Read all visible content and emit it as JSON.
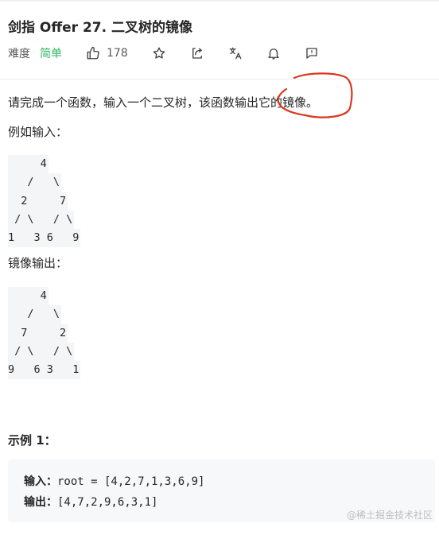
{
  "problem": {
    "title": "剑指 Offer 27. 二叉树的镜像",
    "difficulty_label": "难度",
    "difficulty_value": "简单",
    "likes": "178"
  },
  "toolbar_icons": [
    "thumbs-up-icon",
    "star-icon",
    "share-icon",
    "translate-icon",
    "bell-icon",
    "feedback-icon"
  ],
  "description": {
    "intro": "请完成一个函数，输入一个二叉树，该函数输出它的镜像。",
    "input_label": "例如输入：",
    "input_tree": [
      "     4",
      "   /   \\",
      "  2     7",
      " / \\   / \\",
      "1   3 6   9"
    ],
    "output_label": "镜像输出：",
    "output_tree": [
      "     4",
      "   /   \\",
      "  7     2",
      " / \\   / \\",
      "9   6 3   1"
    ]
  },
  "example": {
    "title": "示例 1：",
    "input_key": "输入：",
    "input_value": "root = [4,2,7,1,3,6,9]",
    "output_key": "输出：",
    "output_value": "[4,7,2,9,6,3,1]"
  },
  "watermark": "@稀土掘金技术社区",
  "colors": {
    "easy": "#2db55d",
    "annotation": "#d9381e",
    "code_bg": "#f7f8fa"
  }
}
